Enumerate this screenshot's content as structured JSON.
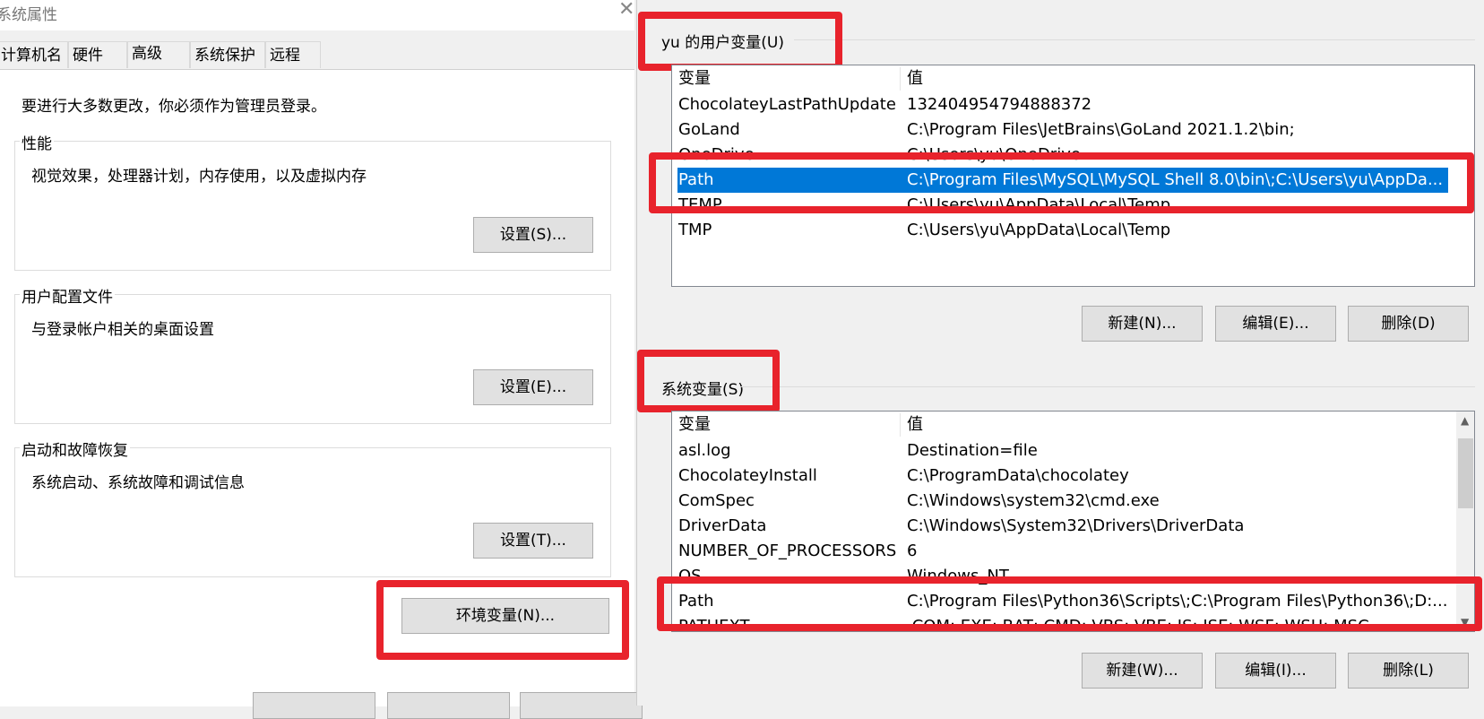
{
  "left": {
    "title": "系统属性",
    "tabs": [
      "计算机名",
      "硬件",
      "高级",
      "系统保护",
      "远程"
    ],
    "notice": "要进行大多数更改，你必须作为管理员登录。",
    "groups": [
      {
        "label": "性能",
        "desc": "视觉效果，处理器计划，内存使用，以及虚拟内存",
        "button": "设置(S)..."
      },
      {
        "label": "用户配置文件",
        "desc": "与登录帐户相关的桌面设置",
        "button": "设置(E)..."
      },
      {
        "label": "启动和故障恢复",
        "desc": "系统启动、系统故障和调试信息",
        "button": "设置(T)..."
      }
    ],
    "env_button": "环境变量(N)..."
  },
  "user_vars": {
    "title": "yu 的用户变量(U)",
    "headers": [
      "变量",
      "值"
    ],
    "rows": [
      {
        "name": "ChocolateyLastPathUpdate",
        "value": "132404954794888372"
      },
      {
        "name": "GoLand",
        "value": "C:\\Program Files\\JetBrains\\GoLand 2021.1.2\\bin;"
      },
      {
        "name": "OneDrive",
        "value": "C:\\Users\\yu\\OneDrive"
      },
      {
        "name": "Path",
        "value": "C:\\Program Files\\MySQL\\MySQL Shell 8.0\\bin\\;C:\\Users\\yu\\AppDa..."
      },
      {
        "name": "TEMP",
        "value": "C:\\Users\\yu\\AppData\\Local\\Temp"
      },
      {
        "name": "TMP",
        "value": "C:\\Users\\yu\\AppData\\Local\\Temp"
      }
    ],
    "buttons": [
      "新建(N)...",
      "编辑(E)...",
      "删除(D)"
    ]
  },
  "system_vars": {
    "title": "系统变量(S)",
    "headers": [
      "变量",
      "值"
    ],
    "rows": [
      {
        "name": "asl.log",
        "value": "Destination=file"
      },
      {
        "name": "ChocolateyInstall",
        "value": "C:\\ProgramData\\chocolatey"
      },
      {
        "name": "ComSpec",
        "value": "C:\\Windows\\system32\\cmd.exe"
      },
      {
        "name": "DriverData",
        "value": "C:\\Windows\\System32\\Drivers\\DriverData"
      },
      {
        "name": "NUMBER_OF_PROCESSORS",
        "value": "6"
      },
      {
        "name": "OS",
        "value": "Windows_NT"
      },
      {
        "name": "Path",
        "value": "C:\\Program Files\\Python36\\Scripts\\;C:\\Program Files\\Python36\\;D:..."
      },
      {
        "name": "PATHEXT",
        "value": ".COM;.EXE;.BAT;.CMD;.VBS;.VBE;.JS;.JSE;.WSF;.WSH;.MSC"
      }
    ],
    "buttons": [
      "新建(W)...",
      "编辑(I)...",
      "删除(L)"
    ]
  },
  "colors": {
    "highlight": "#e8232c",
    "selection": "#0078d7"
  }
}
